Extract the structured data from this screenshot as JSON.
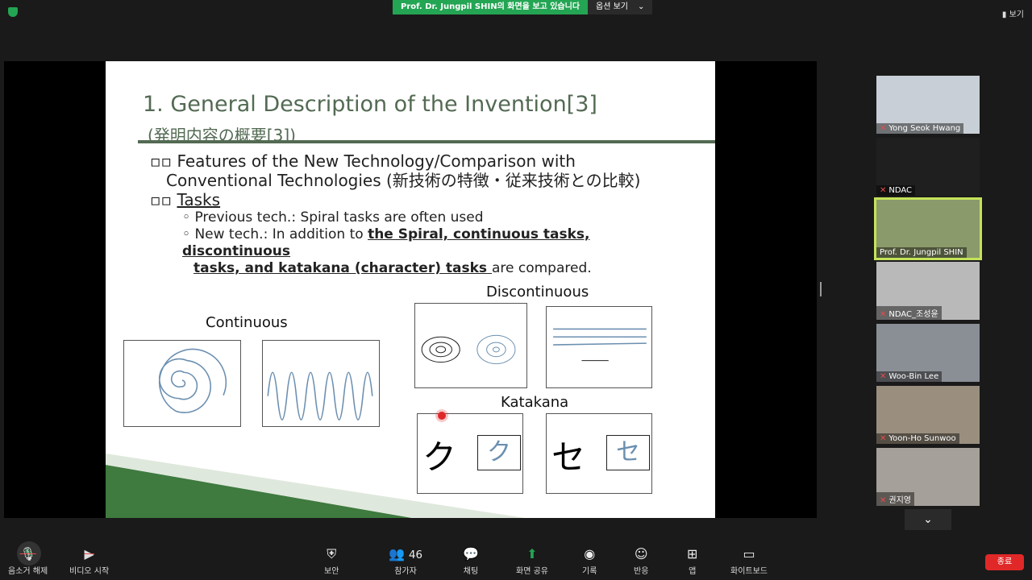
{
  "banner": {
    "sharing": "Prof. Dr. Jungpil SHIN의 화면을 보고 있습니다",
    "options": "옵션 보기",
    "view": "보기"
  },
  "slide": {
    "title": "1. General Description of the Invention[3]",
    "subtitle": "(発明内容の概要[3])",
    "b1_line1": "Features of the New Technology/Comparison with",
    "b1_line2": "Conventional Technologies (新技術の特徴・従来技術との比較)",
    "b2": "Tasks",
    "s1": "Previous tech.: Spiral tasks are often used",
    "s2_pre": "New tech.: In addition to ",
    "s2_u1": "the Spiral, continuous tasks, discontinuous",
    "s2_u2": "tasks, and katakana (character) tasks ",
    "s2_post": "are compared.",
    "label_continuous": "Continuous",
    "label_discontinuous": "Discontinuous",
    "label_katakana": "Katakana",
    "kana1": "ク",
    "kana2": "セ"
  },
  "participants": [
    {
      "name": "Yong Seok Hwang",
      "bg": "#c9cfd6"
    },
    {
      "name": "NDAC",
      "bg": "#1f1f1f"
    },
    {
      "name": "Prof. Dr. Jungpil SHIN",
      "bg": "#8a9a6a"
    },
    {
      "name": "NDAC_조성윤",
      "bg": "#b9b9b9"
    },
    {
      "name": "Woo-Bin Lee",
      "bg": "#8a8f96"
    },
    {
      "name": "Yoon-Ho Sunwoo",
      "bg": "#9a8f7e"
    },
    {
      "name": "권지영",
      "bg": "#a6a09a"
    }
  ],
  "toolbar": {
    "mute": "음소거 해제",
    "video": "비디오 시작",
    "security": "보안",
    "participants": "참가자",
    "participants_count": "46",
    "chat": "채팅",
    "share": "화면 공유",
    "record": "기록",
    "reactions": "반응",
    "apps": "앱",
    "whiteboard": "화이트보드",
    "end": "종료"
  }
}
